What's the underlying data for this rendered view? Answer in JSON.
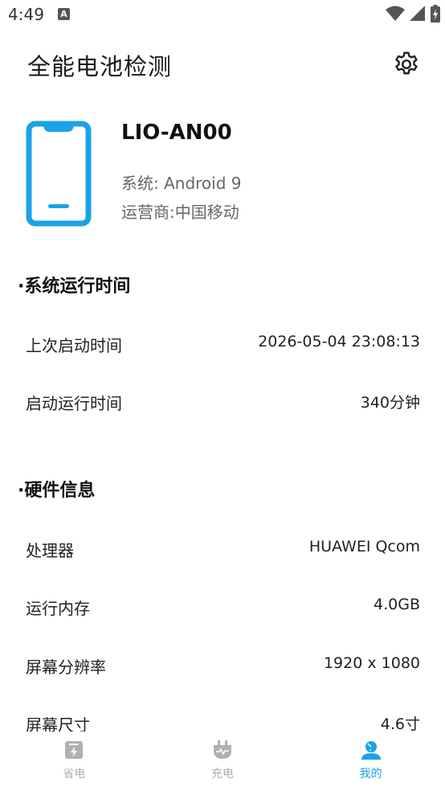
{
  "status_bar": {
    "time": "4:49",
    "notif_letter": "A"
  },
  "header": {
    "title": "全能电池检测"
  },
  "device": {
    "model": "LIO-AN00",
    "os": "系统: Android 9",
    "carrier": "运营商:中国移动"
  },
  "sections": {
    "runtime": {
      "title": "·系统运行时间",
      "rows": [
        {
          "label": "上次启动时间",
          "value": "2026-05-04 23:08:13"
        },
        {
          "label": "启动运行时间",
          "value": "340分钟"
        }
      ]
    },
    "hardware": {
      "title": "·硬件信息",
      "rows": [
        {
          "label": "处理器",
          "value": "HUAWEI Qcom"
        },
        {
          "label": "运行内存",
          "value": "4.0GB"
        },
        {
          "label": "屏幕分辨率",
          "value": "1920 x 1080"
        },
        {
          "label": "屏幕尺寸",
          "value": "4.6寸"
        }
      ]
    }
  },
  "nav": {
    "items": [
      {
        "label": "省电"
      },
      {
        "label": "充电"
      },
      {
        "label": "我的"
      }
    ]
  },
  "colors": {
    "accent": "#1aa3e8",
    "inactive": "#b0b0b0"
  }
}
